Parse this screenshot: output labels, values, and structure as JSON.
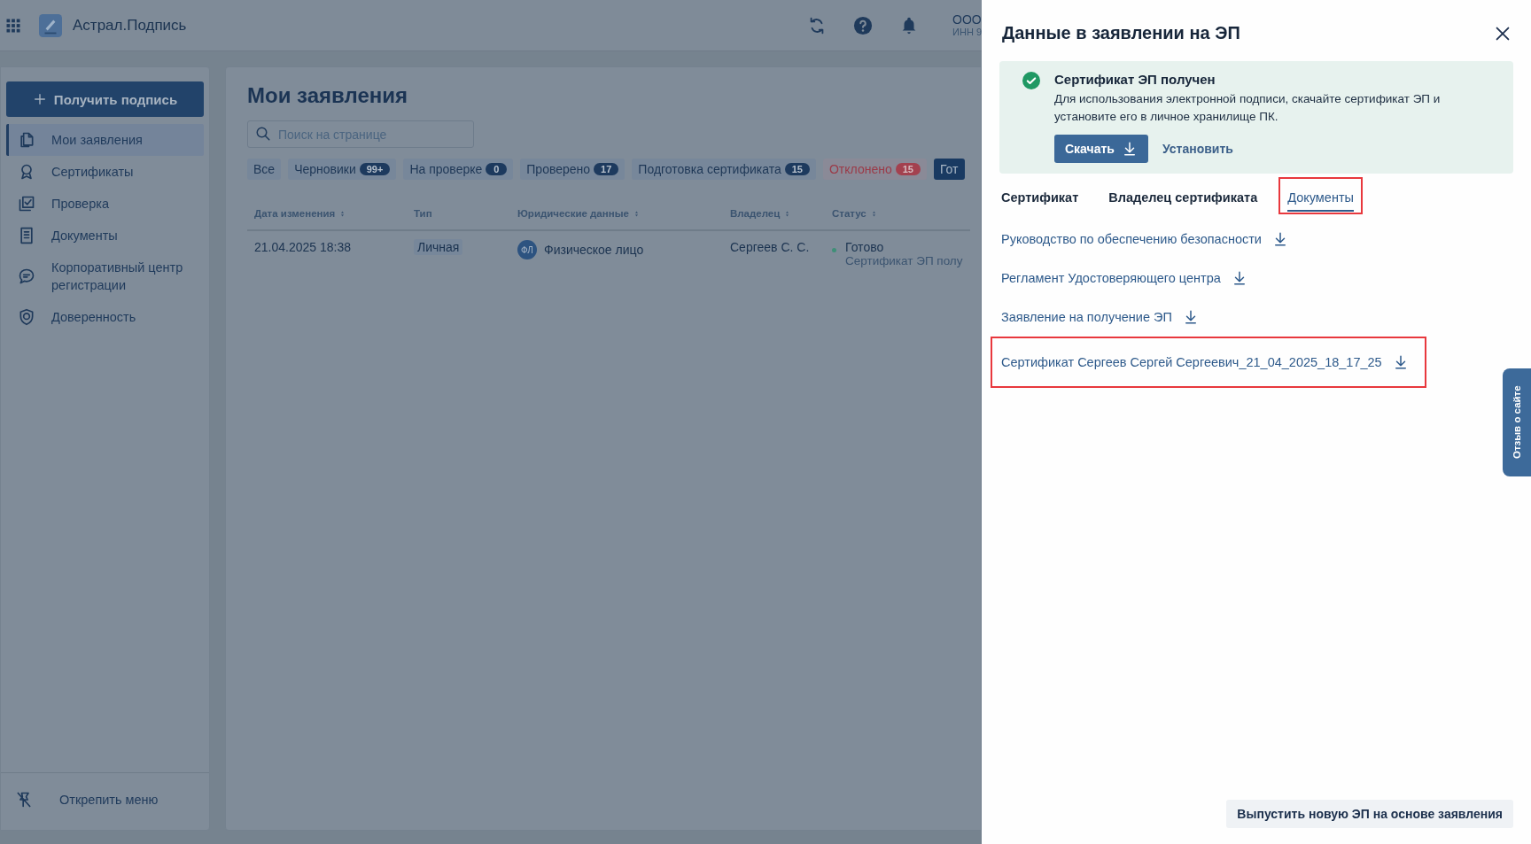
{
  "header": {
    "app_name": "Астрал.Подпись",
    "org": "ООО",
    "inn": "ИНН 9"
  },
  "sidebar": {
    "action": "Получить подпись",
    "items": [
      {
        "label": "Мои заявления",
        "selected": true
      },
      {
        "label": "Сертификаты",
        "selected": false
      },
      {
        "label": "Проверка",
        "selected": false
      },
      {
        "label": "Документы",
        "selected": false
      },
      {
        "label": "Корпоративный центр регистрации",
        "selected": false
      },
      {
        "label": "Доверенность",
        "selected": false
      }
    ],
    "unpin": "Открепить меню"
  },
  "main": {
    "title": "Мои заявления",
    "search": {
      "placeholder": "Поиск на странице"
    },
    "filters": [
      {
        "label": "Все",
        "selected": false,
        "kind": "plain"
      },
      {
        "label": "Черновики",
        "count": "99+",
        "selected": false,
        "kind": "plain"
      },
      {
        "label": "На проверке",
        "count": "0",
        "selected": false,
        "kind": "plain"
      },
      {
        "label": "Проверено",
        "count": "17",
        "selected": false,
        "kind": "plain"
      },
      {
        "label": "Подготовка сертификата",
        "count": "15",
        "selected": false,
        "kind": "plain"
      },
      {
        "label": "Отклонено",
        "count": "15",
        "selected": false,
        "kind": "danger"
      },
      {
        "label": "Гот",
        "selected": true,
        "kind": "plain"
      }
    ],
    "table": {
      "columns": [
        {
          "label": "Дата изменения",
          "sortable": true
        },
        {
          "label": "Тип",
          "sortable": false
        },
        {
          "label": "Юридические данные",
          "sortable": true
        },
        {
          "label": "Владелец",
          "sortable": true
        },
        {
          "label": "Статус",
          "sortable": true
        }
      ],
      "rows": [
        {
          "date": "21.04.2025 18:38",
          "type": "Личная",
          "legal_badge": "ФЛ",
          "legal": "Физическое лицо",
          "owner": "Сергеев С. С.",
          "status": "Готово",
          "status_detail": "Сертификат ЭП полу"
        }
      ]
    }
  },
  "drawer": {
    "title": "Данные в заявлении на ЭП",
    "alert": {
      "title": "Сертификат ЭП получен",
      "text": "Для использования электронной подписи, скачайте сертификат ЭП и установите его в личное хранилище ПК.",
      "download_button": "Скачать",
      "install_link": "Установить"
    },
    "tabs": [
      {
        "label": "Сертификат",
        "selected": false,
        "highlighted": false
      },
      {
        "label": "Владелец сертификата",
        "selected": false,
        "highlighted": false
      },
      {
        "label": "Документы",
        "selected": true,
        "highlighted": true
      }
    ],
    "documents": [
      {
        "label": "Руководство по обеспечению безопасности",
        "highlighted": false
      },
      {
        "label": "Регламент Удостоверяющего центра",
        "highlighted": false
      },
      {
        "label": "Заявление на получение ЭП",
        "highlighted": false
      },
      {
        "label": "Сертификат Сергеев Сергей Сергеевич_21_04_2025_18_17_25",
        "highlighted": true
      }
    ],
    "footer_button": "Выпустить новую ЭП на основе заявления"
  },
  "feedback": "Отзыв о сайте"
}
